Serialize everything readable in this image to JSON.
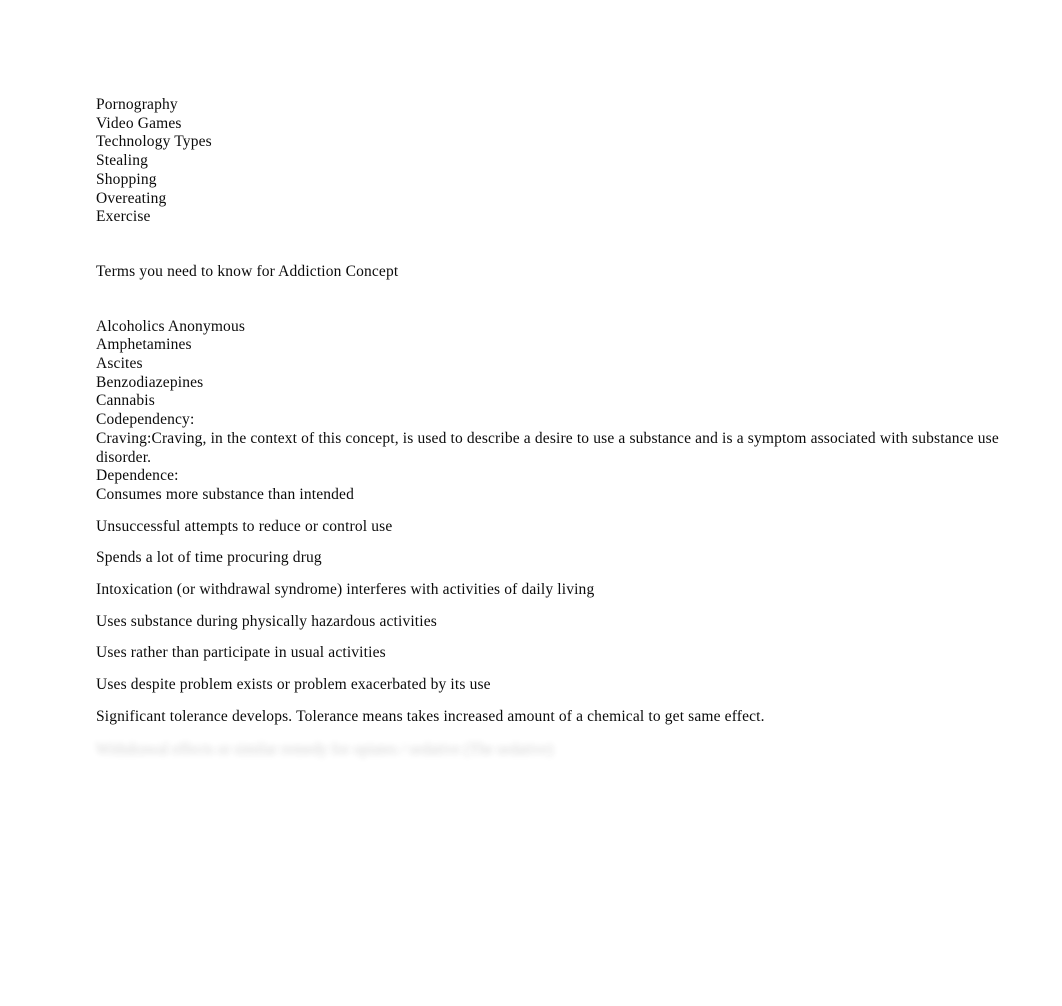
{
  "document": {
    "background_color": "#ffffff",
    "text_color": "#0b0b0b",
    "addiction_types": [
      "Pornography",
      "Video Games",
      "Technology Types",
      "Stealing",
      "Shopping",
      "Overeating",
      "Exercise"
    ],
    "terms_heading": "Terms you need to know for Addiction Concept",
    "terms": [
      "Alcoholics Anonymous",
      "Amphetamines",
      "Ascites",
      "Benzodiazepines",
      "Cannabis",
      "Codependency:"
    ],
    "craving_entry": "Craving:Craving, in the context of this concept, is used to describe a desire to use a substance and is a symptom associated with substance use disorder.",
    "dependence_label": "Dependence:",
    "criteria": [
      "Consumes more substance than intended",
      "Unsuccessful attempts to reduce or control use",
      "Spends a lot of time procuring drug",
      "Intoxication (or withdrawal syndrome) interferes with activities of daily living",
      "Uses substance during physically hazardous activities",
      "Uses rather than participate in usual activities",
      "Uses despite problem exists or problem exacerbated by its use",
      "Significant tolerance develops. Tolerance means takes increased amount of a chemical to get same effect."
    ],
    "final_line_obscured": "Withdrawal effects or similar remedy for opiates / sedative (The sedative)"
  }
}
